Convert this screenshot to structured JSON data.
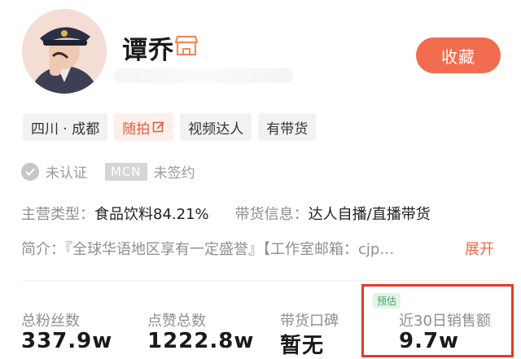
{
  "profile": {
    "name": "谭乔",
    "avatar_icon": "avatar-image",
    "shop_icon": "shop-icon"
  },
  "favorite_button": "收藏",
  "tags": [
    {
      "label": "四川 · 成都",
      "style": "gray"
    },
    {
      "label": "随拍",
      "style": "orange",
      "icon": "edit-icon"
    },
    {
      "label": "视频达人",
      "style": "gray"
    },
    {
      "label": "有带货",
      "style": "gray"
    }
  ],
  "auth": {
    "status": "未认证",
    "mcn_badge": "MCN",
    "mcn_status": "未签约"
  },
  "info": {
    "category_label": "主营类型：",
    "category_value": "食品饮料84.21%",
    "sales_label": "带货信息：",
    "sales_value": "达人自播/直播带货"
  },
  "intro": {
    "text": "简介：『全球华语地区享有一定盛誉』【工作室邮箱：cjp…",
    "expand": "展开"
  },
  "stats": {
    "followers_label": "总粉丝数",
    "followers_value": "337.9w",
    "likes_label": "点赞总数",
    "likes_value": "1222.8w",
    "reputation_label": "带货口碑",
    "reputation_value": "暂无",
    "estimate_badge": "预估",
    "sales_label": "近30日销售额",
    "sales_value": "9.7w"
  },
  "colors": {
    "accent": "#f26d4f",
    "highlight_border": "#e23b2c",
    "estimate_green": "#3fa565"
  }
}
